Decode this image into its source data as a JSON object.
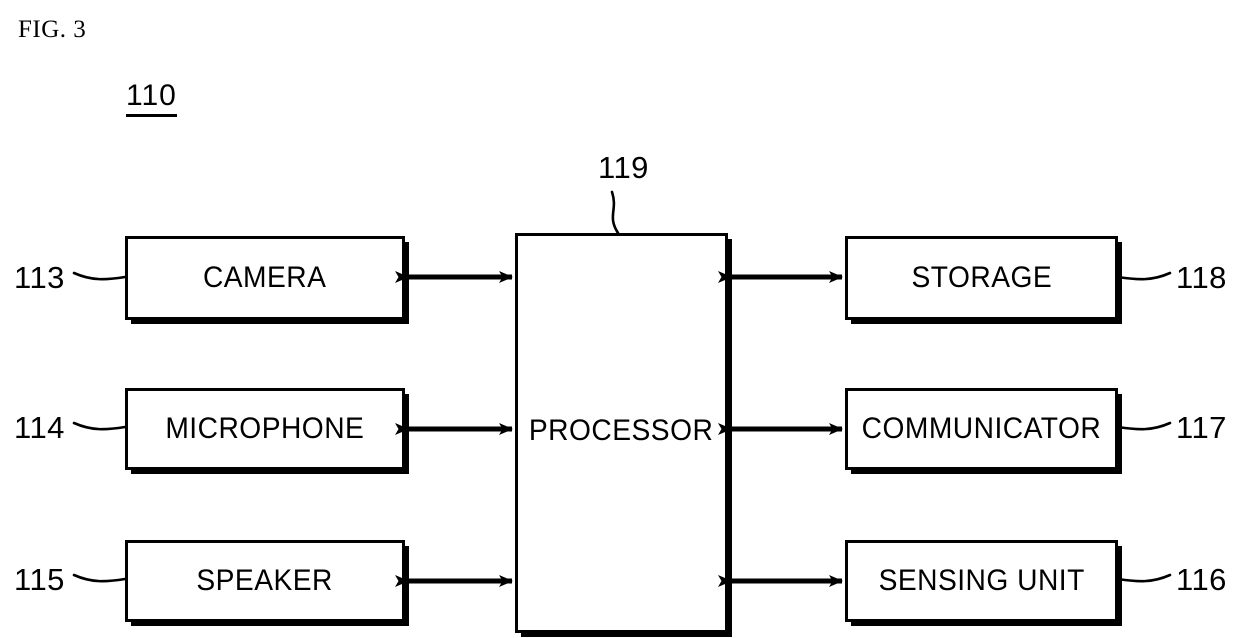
{
  "figure": {
    "caption": "FIG. 3",
    "assembly_number": "110"
  },
  "processor": {
    "label": "PROCESSOR",
    "ref": "119"
  },
  "left_blocks": [
    {
      "label": "CAMERA",
      "ref": "113"
    },
    {
      "label": "MICROPHONE",
      "ref": "114"
    },
    {
      "label": "SPEAKER",
      "ref": "115"
    }
  ],
  "right_blocks": [
    {
      "label": "STORAGE",
      "ref": "118"
    },
    {
      "label": "COMMUNICATOR",
      "ref": "117"
    },
    {
      "label": "SENSING UNIT",
      "ref": "116"
    }
  ],
  "style": {
    "line_color": "#000000",
    "background": "#ffffff"
  },
  "connections": [
    {
      "from": "CAMERA",
      "to": "PROCESSOR",
      "type": "bidirectional"
    },
    {
      "from": "MICROPHONE",
      "to": "PROCESSOR",
      "type": "bidirectional"
    },
    {
      "from": "SPEAKER",
      "to": "PROCESSOR",
      "type": "bidirectional"
    },
    {
      "from": "PROCESSOR",
      "to": "STORAGE",
      "type": "bidirectional"
    },
    {
      "from": "PROCESSOR",
      "to": "COMMUNICATOR",
      "type": "bidirectional"
    },
    {
      "from": "PROCESSOR",
      "to": "SENSING UNIT",
      "type": "bidirectional"
    }
  ]
}
